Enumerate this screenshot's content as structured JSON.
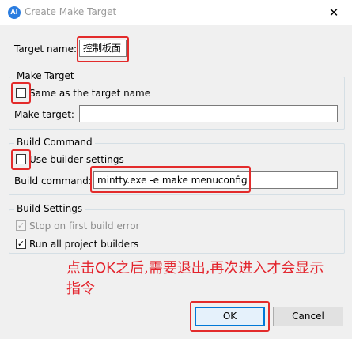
{
  "window": {
    "title": "Create Make Target",
    "app_icon_text": "AI",
    "close_glyph": "✕"
  },
  "fields": {
    "target_name_label": "Target name:",
    "target_name_value": "控制板面",
    "make_target_label": "Make target:",
    "make_target_value": "",
    "build_command_label": "Build command:",
    "build_command_value": "mintty.exe -e make menuconfig"
  },
  "groups": {
    "make_target": {
      "title": "Make Target",
      "same_as_target_name": {
        "label": "Same as the target name",
        "checked": false
      }
    },
    "build_command": {
      "title": "Build Command",
      "use_builder_settings": {
        "label": "Use builder settings",
        "checked": false
      }
    },
    "build_settings": {
      "title": "Build Settings",
      "stop_on_first_error": {
        "label": "Stop on first build error",
        "checked": true,
        "enabled": false
      },
      "run_all_builders": {
        "label": "Run all project builders",
        "checked": true,
        "enabled": true
      }
    }
  },
  "annotation": {
    "text": "点击OK之后,需要退出,再次进入才会显示指令",
    "color": "#e3232c"
  },
  "buttons": {
    "ok": "OK",
    "cancel": "Cancel"
  },
  "colors": {
    "highlight_box": "#e32b2b",
    "default_button_border": "#0078d7"
  }
}
